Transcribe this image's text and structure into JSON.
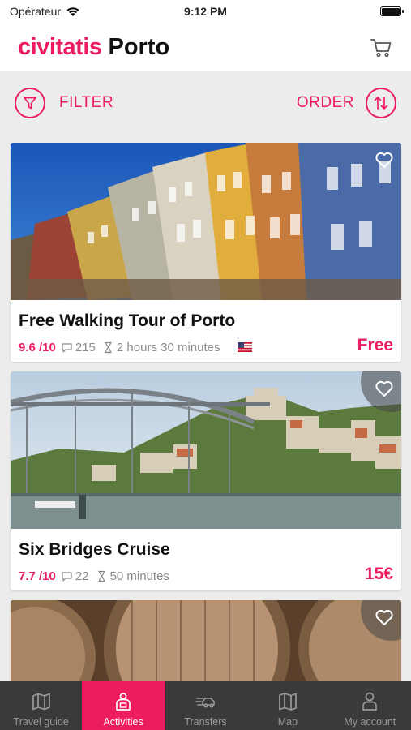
{
  "status_bar": {
    "carrier": "Opérateur",
    "time": "9:12 PM"
  },
  "header": {
    "brand": "civitatis",
    "city": "Porto"
  },
  "toolbar": {
    "filter_label": "FILTER",
    "order_label": "ORDER"
  },
  "colors": {
    "accent": "#ec1d5f",
    "tabbar": "#3a3a3a"
  },
  "activities": [
    {
      "title": "Free Walking Tour of Porto",
      "rating": "9.6 /10",
      "reviews": "215",
      "duration": "2 hours 30 minutes",
      "price": "Free",
      "language_flag": "us-flag-icon"
    },
    {
      "title": "Six Bridges Cruise",
      "rating": "7.7 /10",
      "reviews": "22",
      "duration": "50 minutes",
      "price": "15€"
    },
    {
      "title": "",
      "image": "wine-barrels"
    }
  ],
  "tabs": [
    {
      "label": "Travel guide",
      "icon": "map-book-icon",
      "active": false
    },
    {
      "label": "Activities",
      "icon": "activities-icon",
      "active": true
    },
    {
      "label": "Transfers",
      "icon": "transfer-car-icon",
      "active": false
    },
    {
      "label": "Map",
      "icon": "map-icon",
      "active": false
    },
    {
      "label": "My account",
      "icon": "user-icon",
      "active": false
    }
  ]
}
